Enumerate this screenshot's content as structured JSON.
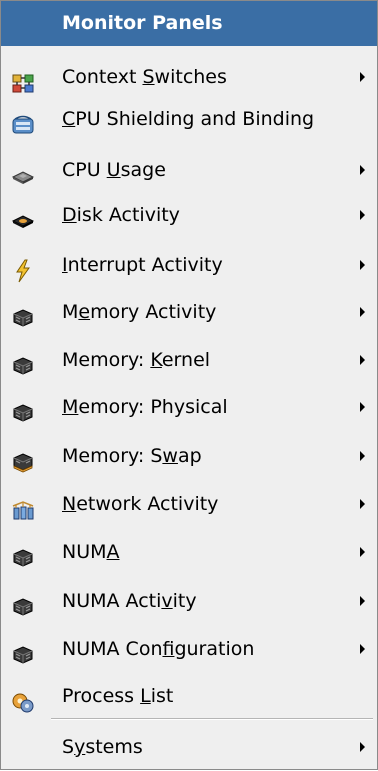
{
  "menu": {
    "title": "Monitor Panels",
    "items": [
      {
        "pre": "Context ",
        "mn": "S",
        "post": "witches",
        "icon": "context-switch-icon",
        "submenu": true
      },
      {
        "pre": "",
        "mn": "C",
        "post": "PU Shielding and Binding",
        "icon": "cpu-shield-icon",
        "submenu": false
      },
      {
        "pre": "CPU ",
        "mn": "U",
        "post": "sage",
        "icon": "cpu-chip-icon",
        "submenu": true
      },
      {
        "pre": "",
        "mn": "D",
        "post": "isk Activity",
        "icon": "disk-icon",
        "submenu": true
      },
      {
        "pre": "",
        "mn": "I",
        "post": "nterrupt Activity",
        "icon": "lightning-icon",
        "submenu": true
      },
      {
        "pre": "M",
        "mn": "e",
        "post": "mory Activity",
        "icon": "memory-chip-icon",
        "submenu": true
      },
      {
        "pre": "Memory: ",
        "mn": "K",
        "post": "ernel",
        "icon": "memory-chip-icon",
        "submenu": true
      },
      {
        "pre": "",
        "mn": "M",
        "post": "emory: Physical",
        "icon": "memory-chip-icon",
        "submenu": true
      },
      {
        "pre": "Memory: S",
        "mn": "w",
        "post": "ap",
        "icon": "memory-swap-icon",
        "submenu": true
      },
      {
        "pre": "",
        "mn": "N",
        "post": "etwork Activity",
        "icon": "network-icon",
        "submenu": true
      },
      {
        "pre": "NUM",
        "mn": "A",
        "post": "",
        "icon": "memory-chip-icon",
        "submenu": true
      },
      {
        "pre": "NUMA Acti",
        "mn": "v",
        "post": "ity",
        "icon": "memory-chip-icon",
        "submenu": true
      },
      {
        "pre": "NUMA Con",
        "mn": "f",
        "post": "iguration",
        "icon": "memory-chip-icon",
        "submenu": true
      },
      {
        "pre": "Process ",
        "mn": "L",
        "post": "ist",
        "icon": "process-gear-icon",
        "submenu": false
      },
      {
        "pre": "S",
        "mn": "y",
        "post": "stems",
        "icon": "",
        "submenu": true
      }
    ]
  }
}
